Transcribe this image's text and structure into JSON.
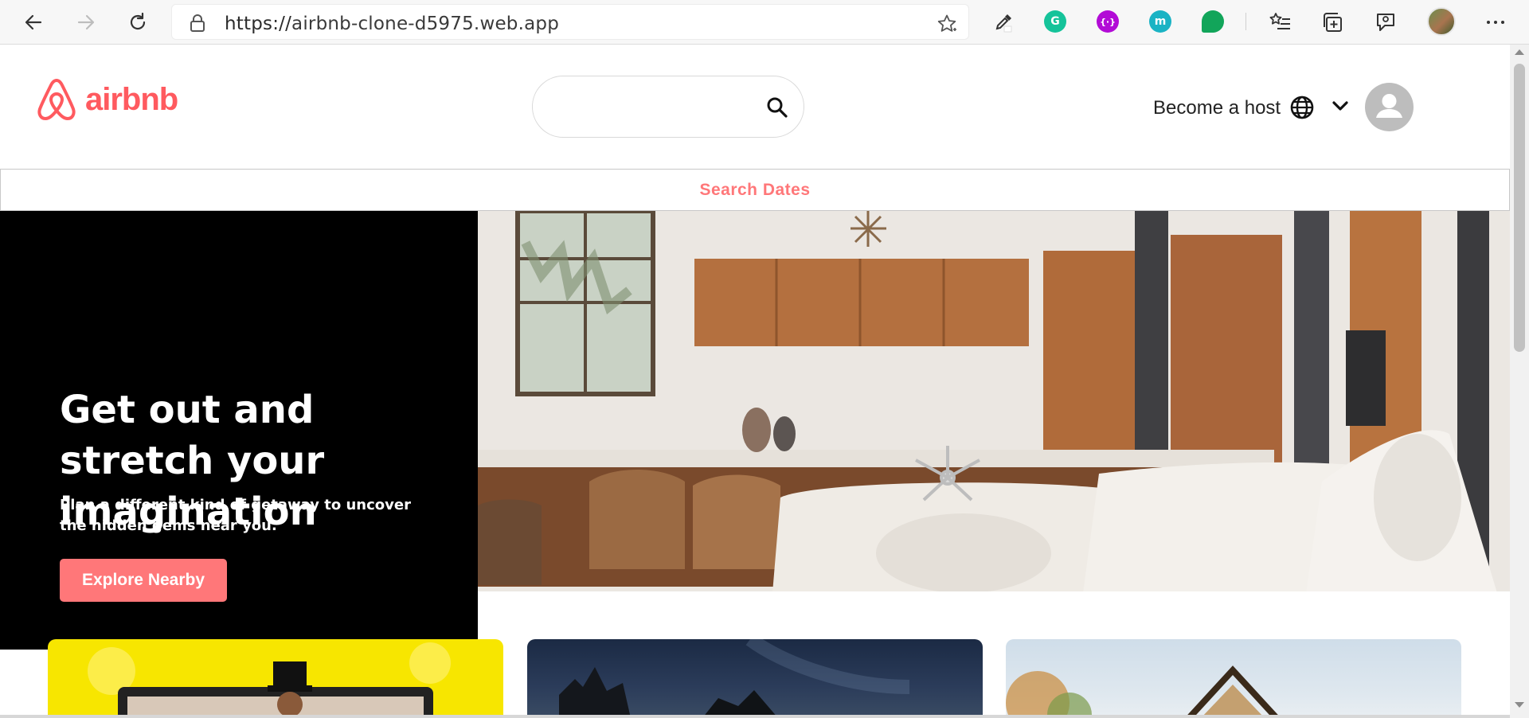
{
  "browser": {
    "url_scheme": "https://",
    "url_host": "airbnb-clone-d5975.web.app",
    "extensions": [
      {
        "name": "grammarly",
        "letter": "G",
        "color": "#15c39a"
      },
      {
        "name": "purple-extension",
        "letter": "{·}",
        "color": "#b20bd6"
      },
      {
        "name": "m-extension",
        "letter": "m",
        "color": "#1ab3c4"
      },
      {
        "name": "chat-extension",
        "letter": "",
        "color": "#12a55a"
      }
    ]
  },
  "header": {
    "logo_text": "airbnb",
    "brand_color": "#ff5a5f",
    "search_placeholder": "",
    "host_link": "Become a host"
  },
  "dates_bar": {
    "label": "Search Dates",
    "accent_color": "#ff7779"
  },
  "hero": {
    "title": "Get out and stretch your imagination",
    "subtitle": "Plan a different kind of getaway to uncover the hidden gems near you.",
    "button_label": "Explore Nearby"
  }
}
